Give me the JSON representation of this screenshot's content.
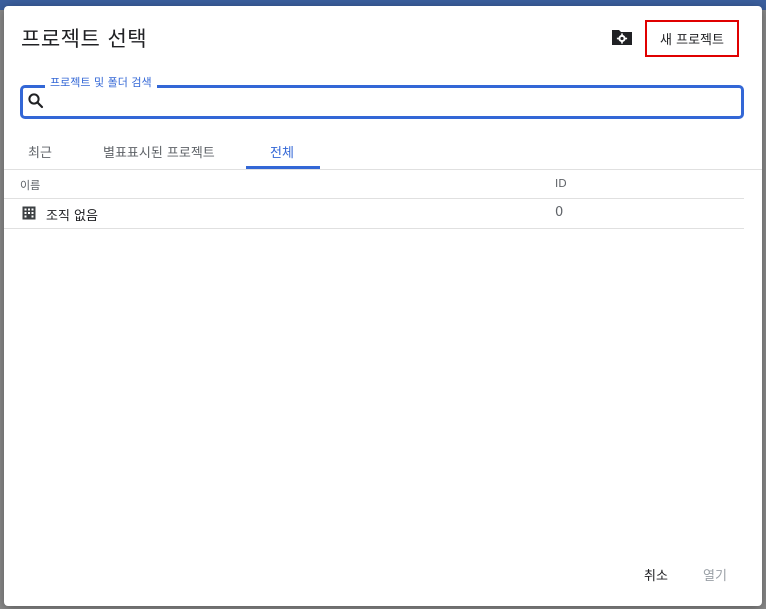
{
  "dialog": {
    "title": "프로젝트 선택",
    "new_project_label": "새 프로젝트",
    "settings_icon": "folder-gear-icon"
  },
  "search": {
    "label": "프로젝트 및 폴더 검색",
    "value": "",
    "icon": "search-icon"
  },
  "tabs": [
    {
      "label": "최근",
      "active": false
    },
    {
      "label": "별표표시된 프로젝트",
      "active": false
    },
    {
      "label": "전체",
      "active": true
    }
  ],
  "table": {
    "columns": [
      "이름",
      "ID"
    ],
    "rows": [
      {
        "icon": "organization-icon",
        "name": "조직 없음",
        "id": "0"
      }
    ]
  },
  "footer": {
    "cancel_label": "취소",
    "open_label": "열기"
  },
  "colors": {
    "accent": "#3367d6",
    "highlight_border": "#e00000"
  }
}
